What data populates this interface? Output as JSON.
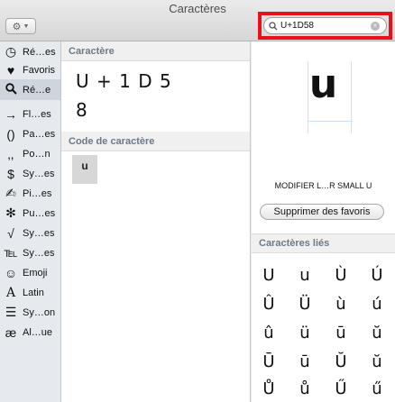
{
  "window": {
    "title": "Caractères"
  },
  "search": {
    "value": "U+1D58"
  },
  "sidebar": {
    "items": [
      {
        "label": "Ré…es",
        "icon": "clock-icon",
        "glyph": "◷"
      },
      {
        "label": "Favoris",
        "icon": "heart-icon",
        "glyph": "♥"
      },
      {
        "label": "Ré…e",
        "icon": "search-icon",
        "glyph": "⌕"
      },
      {
        "label": "Fl…es",
        "icon": "arrow-icon",
        "glyph": "→"
      },
      {
        "label": "Pa…es",
        "icon": "parentheses-icon",
        "glyph": "()"
      },
      {
        "label": "Po…n",
        "icon": "punctuation-icon",
        "glyph": "‚,"
      },
      {
        "label": "Sy…es",
        "icon": "currency-icon",
        "glyph": "$"
      },
      {
        "label": "Pi…es",
        "icon": "pictograph-icon",
        "glyph": "✍"
      },
      {
        "label": "Pu…es",
        "icon": "bullet-icon",
        "glyph": "✻"
      },
      {
        "label": "Sy…es",
        "icon": "math-icon",
        "glyph": "√"
      },
      {
        "label": "Sy…es",
        "icon": "letterlike-icon",
        "glyph": "℡"
      },
      {
        "label": "Emoji",
        "icon": "emoji-icon",
        "glyph": "☺"
      },
      {
        "label": "Latin",
        "icon": "latin-icon",
        "glyph": "A"
      },
      {
        "label": "Sy…on",
        "icon": "list-icon",
        "glyph": "☰"
      },
      {
        "label": "Al…ue",
        "icon": "ae-icon",
        "glyph": "æ"
      }
    ]
  },
  "middle": {
    "char_header": "Caractère",
    "sequence_line1": "U + 1 D 5",
    "sequence_line2": "8",
    "code_header": "Code de caractère",
    "code_char": "u"
  },
  "detail": {
    "glyph": "u",
    "name": "MODIFIER L…R SMALL U",
    "fav_button": "Supprimer des favoris",
    "related_header": "Caractères liés",
    "related": [
      "U",
      "u",
      "Ù",
      "Ú",
      "Û",
      "Ü",
      "ù",
      "ú",
      "û",
      "ü",
      "ū",
      "ŭ",
      "Ū",
      "ū",
      "Ŭ",
      "ŭ",
      "Ů",
      "ů",
      "Ű",
      "ű"
    ]
  }
}
